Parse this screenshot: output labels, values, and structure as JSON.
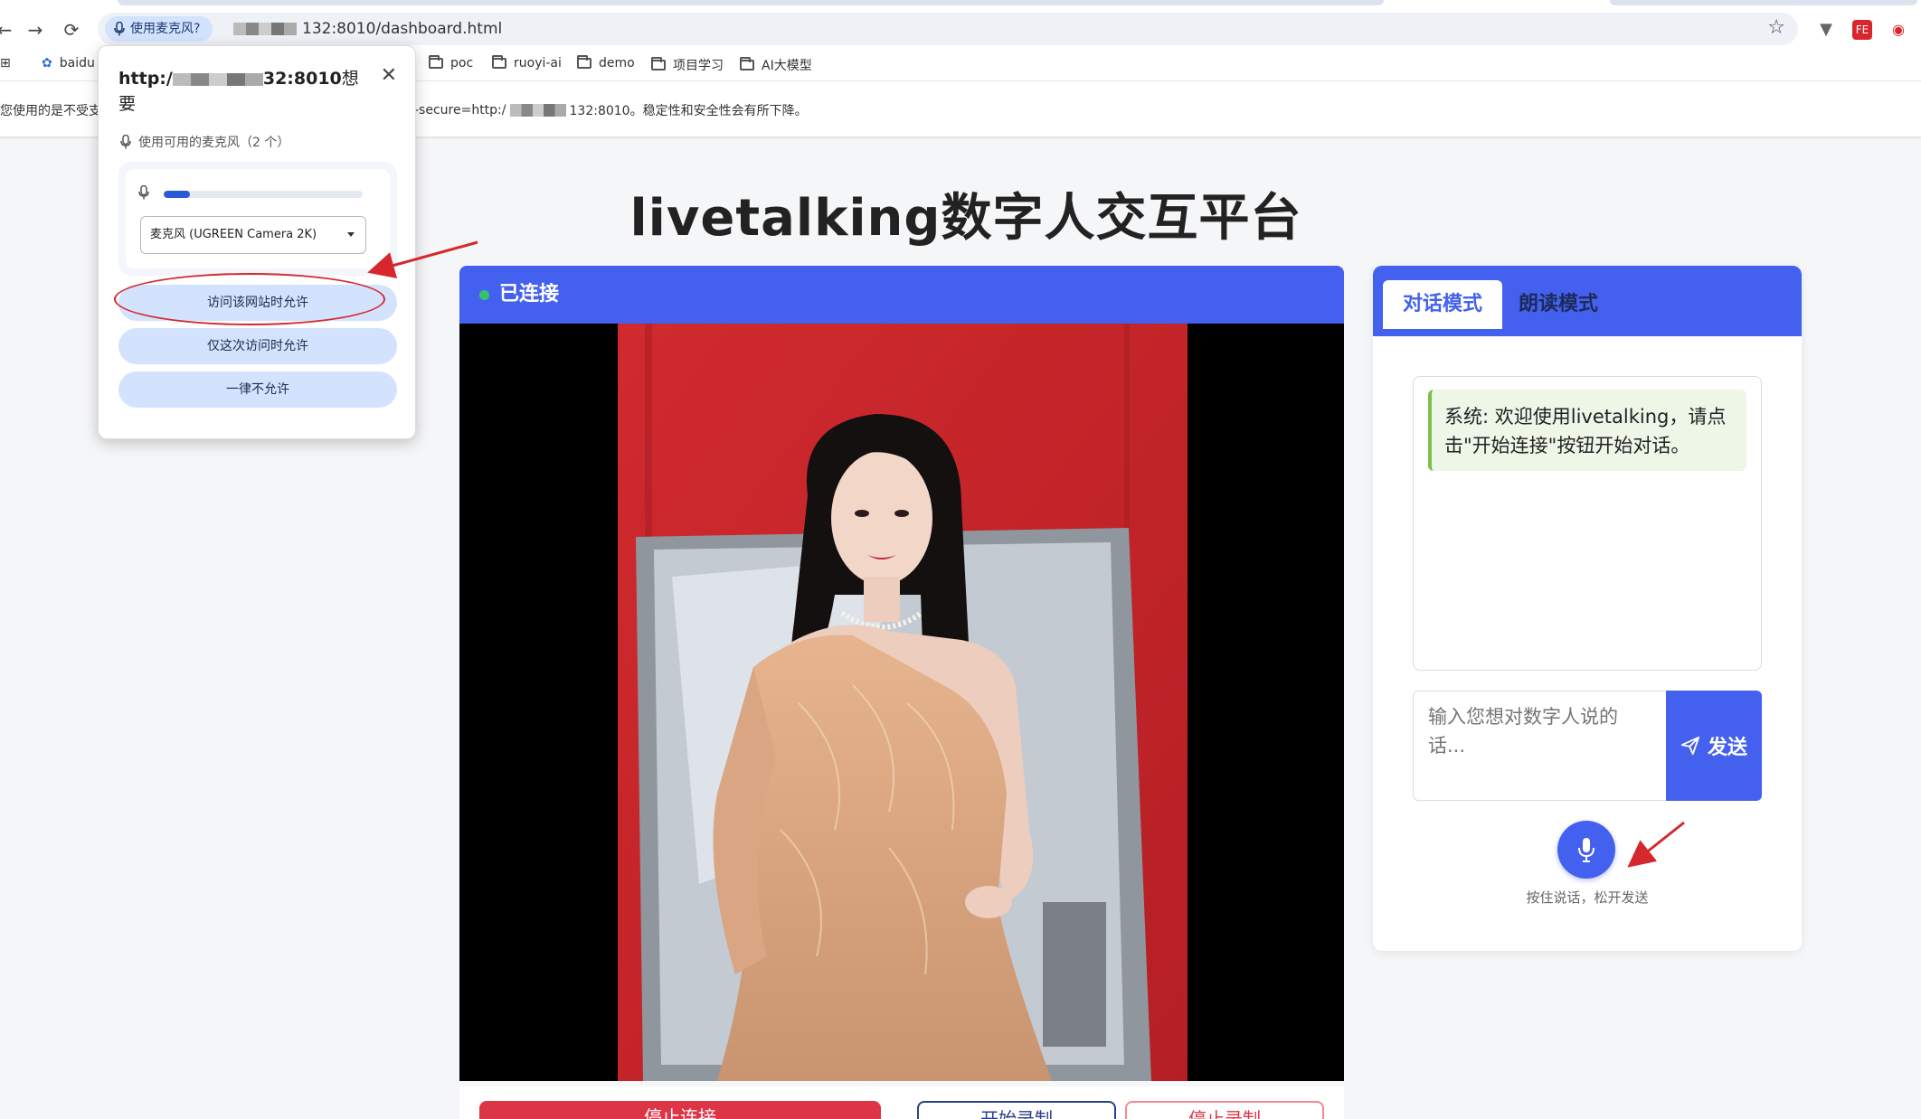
{
  "browser": {
    "permission_chip": "使用麦克风?",
    "url_suffix": "132:8010/dashboard.html",
    "bookmarks": [
      "baidu",
      "poc",
      "ruoyi-ai",
      "demo",
      "项目学习",
      "AI大模型"
    ],
    "extension_label": "FE",
    "infobar": {
      "left_text": "您使用的是不受支",
      "right_text_prefix": "-secure=http:/",
      "right_text_suffix": "132:8010。稳定性和安全性会有所下降。"
    }
  },
  "permission_popup": {
    "title_prefix": "http:/",
    "title_suffix": "32:8010",
    "title_end": "想要",
    "subtitle": "使用可用的麦克风（2 个）",
    "mic_level": 0.13,
    "selected_mic": "麦克风 (UGREEN Camera 2K)",
    "allow_always": "访问该网站时允许",
    "allow_once": "仅这次访问时允许",
    "deny": "一律不允许",
    "close_label": "✕"
  },
  "page": {
    "title": "livetalking数字人交互平台"
  },
  "video": {
    "status": "已连接",
    "status_color": "#33c36b"
  },
  "controls": {
    "stop": "停止连接",
    "start_record": "开始录制",
    "stop_record": "停止录制"
  },
  "chat": {
    "tab_dialog": "对话模式",
    "tab_read": "朗读模式",
    "system_message": "系统: 欢迎使用livetalking，请点击\"开始连接\"按钮开始对话。",
    "input_placeholder": "输入您想对数字人说的话...",
    "send": "发送",
    "mic_hint": "按住说话，松开发送"
  },
  "colors": {
    "accent": "#4361ee",
    "stop_button": "#dc3545",
    "annotation": "#d6282c"
  }
}
